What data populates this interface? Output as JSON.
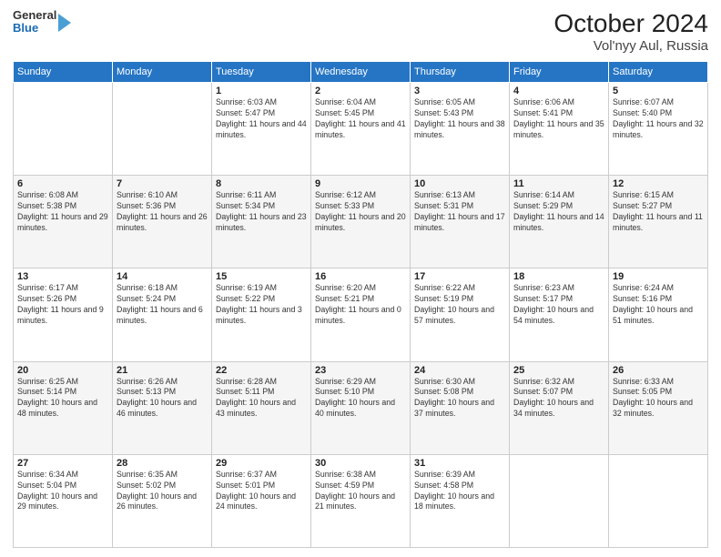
{
  "header": {
    "logo_general": "General",
    "logo_blue": "Blue",
    "title": "October 2024",
    "subtitle": "Vol'nyy Aul, Russia"
  },
  "days_of_week": [
    "Sunday",
    "Monday",
    "Tuesday",
    "Wednesday",
    "Thursday",
    "Friday",
    "Saturday"
  ],
  "weeks": [
    [
      {
        "day": "",
        "info": ""
      },
      {
        "day": "",
        "info": ""
      },
      {
        "day": "1",
        "info": "Sunrise: 6:03 AM\nSunset: 5:47 PM\nDaylight: 11 hours and 44 minutes."
      },
      {
        "day": "2",
        "info": "Sunrise: 6:04 AM\nSunset: 5:45 PM\nDaylight: 11 hours and 41 minutes."
      },
      {
        "day": "3",
        "info": "Sunrise: 6:05 AM\nSunset: 5:43 PM\nDaylight: 11 hours and 38 minutes."
      },
      {
        "day": "4",
        "info": "Sunrise: 6:06 AM\nSunset: 5:41 PM\nDaylight: 11 hours and 35 minutes."
      },
      {
        "day": "5",
        "info": "Sunrise: 6:07 AM\nSunset: 5:40 PM\nDaylight: 11 hours and 32 minutes."
      }
    ],
    [
      {
        "day": "6",
        "info": "Sunrise: 6:08 AM\nSunset: 5:38 PM\nDaylight: 11 hours and 29 minutes."
      },
      {
        "day": "7",
        "info": "Sunrise: 6:10 AM\nSunset: 5:36 PM\nDaylight: 11 hours and 26 minutes."
      },
      {
        "day": "8",
        "info": "Sunrise: 6:11 AM\nSunset: 5:34 PM\nDaylight: 11 hours and 23 minutes."
      },
      {
        "day": "9",
        "info": "Sunrise: 6:12 AM\nSunset: 5:33 PM\nDaylight: 11 hours and 20 minutes."
      },
      {
        "day": "10",
        "info": "Sunrise: 6:13 AM\nSunset: 5:31 PM\nDaylight: 11 hours and 17 minutes."
      },
      {
        "day": "11",
        "info": "Sunrise: 6:14 AM\nSunset: 5:29 PM\nDaylight: 11 hours and 14 minutes."
      },
      {
        "day": "12",
        "info": "Sunrise: 6:15 AM\nSunset: 5:27 PM\nDaylight: 11 hours and 11 minutes."
      }
    ],
    [
      {
        "day": "13",
        "info": "Sunrise: 6:17 AM\nSunset: 5:26 PM\nDaylight: 11 hours and 9 minutes."
      },
      {
        "day": "14",
        "info": "Sunrise: 6:18 AM\nSunset: 5:24 PM\nDaylight: 11 hours and 6 minutes."
      },
      {
        "day": "15",
        "info": "Sunrise: 6:19 AM\nSunset: 5:22 PM\nDaylight: 11 hours and 3 minutes."
      },
      {
        "day": "16",
        "info": "Sunrise: 6:20 AM\nSunset: 5:21 PM\nDaylight: 11 hours and 0 minutes."
      },
      {
        "day": "17",
        "info": "Sunrise: 6:22 AM\nSunset: 5:19 PM\nDaylight: 10 hours and 57 minutes."
      },
      {
        "day": "18",
        "info": "Sunrise: 6:23 AM\nSunset: 5:17 PM\nDaylight: 10 hours and 54 minutes."
      },
      {
        "day": "19",
        "info": "Sunrise: 6:24 AM\nSunset: 5:16 PM\nDaylight: 10 hours and 51 minutes."
      }
    ],
    [
      {
        "day": "20",
        "info": "Sunrise: 6:25 AM\nSunset: 5:14 PM\nDaylight: 10 hours and 48 minutes."
      },
      {
        "day": "21",
        "info": "Sunrise: 6:26 AM\nSunset: 5:13 PM\nDaylight: 10 hours and 46 minutes."
      },
      {
        "day": "22",
        "info": "Sunrise: 6:28 AM\nSunset: 5:11 PM\nDaylight: 10 hours and 43 minutes."
      },
      {
        "day": "23",
        "info": "Sunrise: 6:29 AM\nSunset: 5:10 PM\nDaylight: 10 hours and 40 minutes."
      },
      {
        "day": "24",
        "info": "Sunrise: 6:30 AM\nSunset: 5:08 PM\nDaylight: 10 hours and 37 minutes."
      },
      {
        "day": "25",
        "info": "Sunrise: 6:32 AM\nSunset: 5:07 PM\nDaylight: 10 hours and 34 minutes."
      },
      {
        "day": "26",
        "info": "Sunrise: 6:33 AM\nSunset: 5:05 PM\nDaylight: 10 hours and 32 minutes."
      }
    ],
    [
      {
        "day": "27",
        "info": "Sunrise: 6:34 AM\nSunset: 5:04 PM\nDaylight: 10 hours and 29 minutes."
      },
      {
        "day": "28",
        "info": "Sunrise: 6:35 AM\nSunset: 5:02 PM\nDaylight: 10 hours and 26 minutes."
      },
      {
        "day": "29",
        "info": "Sunrise: 6:37 AM\nSunset: 5:01 PM\nDaylight: 10 hours and 24 minutes."
      },
      {
        "day": "30",
        "info": "Sunrise: 6:38 AM\nSunset: 4:59 PM\nDaylight: 10 hours and 21 minutes."
      },
      {
        "day": "31",
        "info": "Sunrise: 6:39 AM\nSunset: 4:58 PM\nDaylight: 10 hours and 18 minutes."
      },
      {
        "day": "",
        "info": ""
      },
      {
        "day": "",
        "info": ""
      }
    ]
  ]
}
